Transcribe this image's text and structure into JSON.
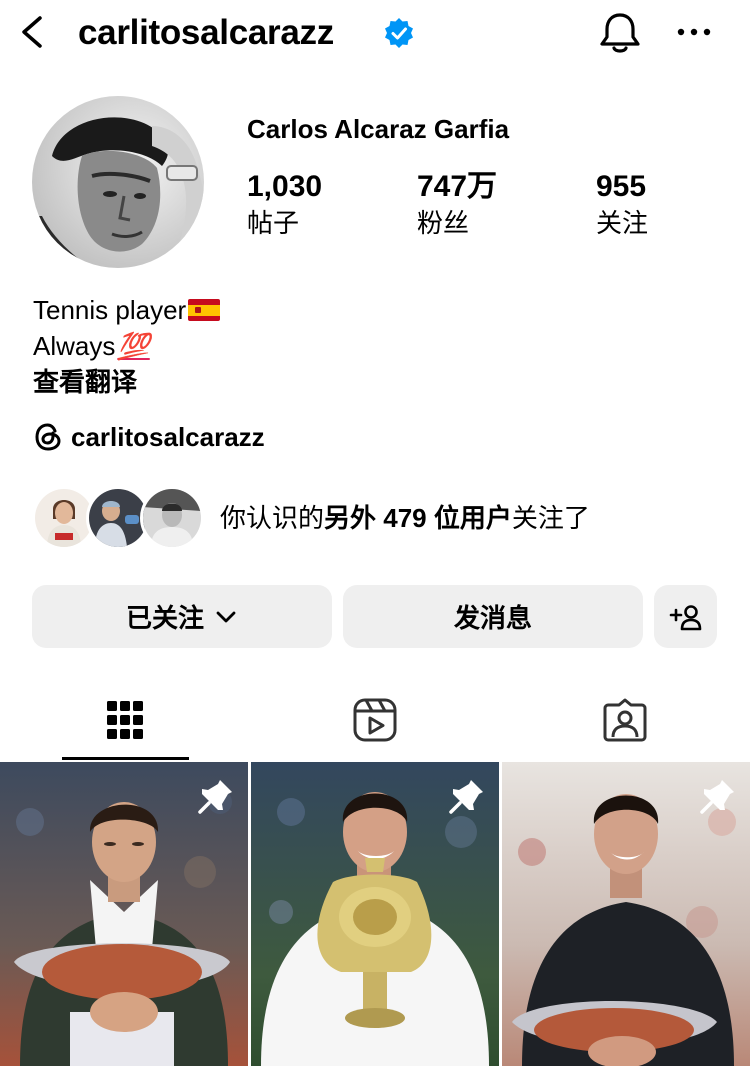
{
  "header": {
    "username": "carlitosalcarazz",
    "verified": true,
    "icons": [
      "back-arrow-icon",
      "verified-badge-icon",
      "bell-icon",
      "more-icon"
    ]
  },
  "profile": {
    "full_name": "Carlos Alcaraz Garfia",
    "stats": {
      "posts": {
        "value": "1,030",
        "label": "帖子"
      },
      "followers": {
        "value": "747万",
        "label": "粉丝"
      },
      "following": {
        "value": "955",
        "label": "关注"
      }
    },
    "bio": {
      "line1": "Tennis player",
      "line1_emoji": "spain-flag",
      "line2": "Always",
      "line2_emoji": "💯",
      "translate": "查看翻译"
    },
    "threads_handle": "carlitosalcarazz"
  },
  "mutuals": {
    "prefix": "你认识的",
    "highlight": "另外 479 位用户",
    "suffix": "关注了"
  },
  "actions": {
    "following_label": "已关注",
    "message_label": "发消息"
  },
  "tabs": [
    "grid-icon",
    "reels-icon",
    "tagged-icon"
  ],
  "posts": [
    {
      "pinned": true,
      "subject": "player holding trophy, dark jacket"
    },
    {
      "pinned": true,
      "subject": "player holding gold trophy, white jacket"
    },
    {
      "pinned": true,
      "subject": "player holding trophy, black jacket"
    }
  ],
  "colors": {
    "verified_blue": "#0095f6",
    "button_bg": "#efefef",
    "text": "#000000"
  }
}
